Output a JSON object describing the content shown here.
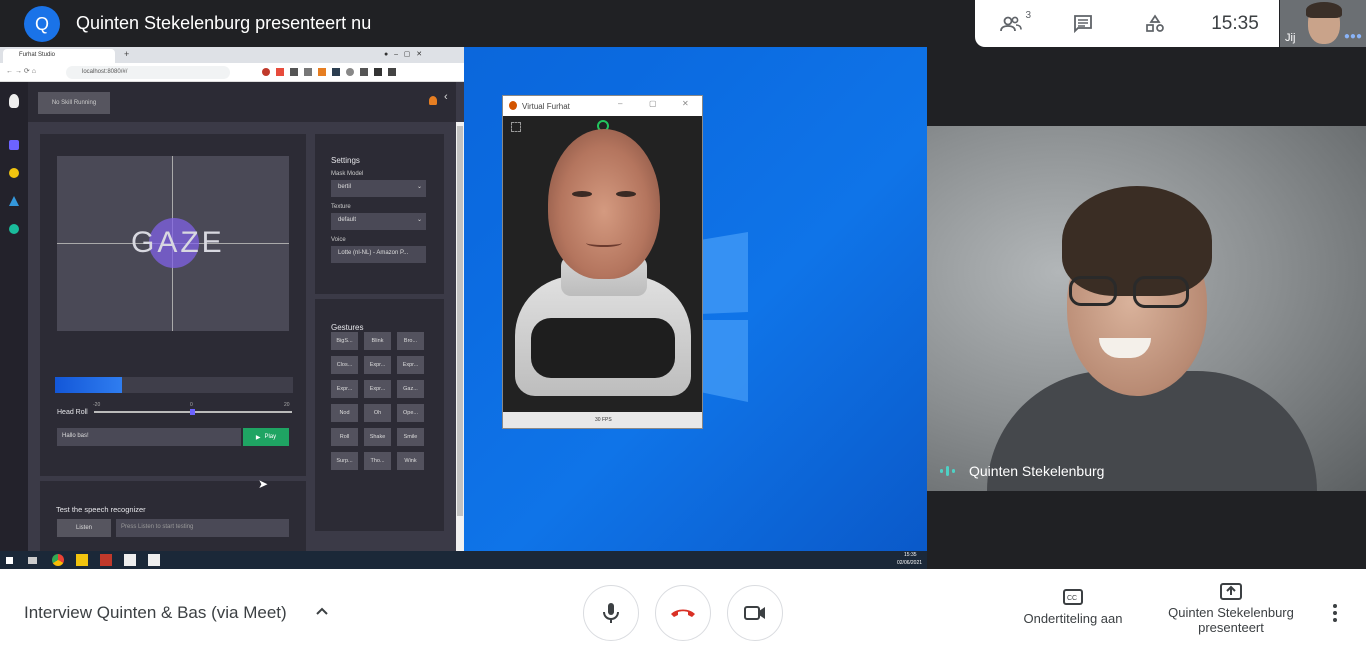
{
  "header": {
    "avatar_letter": "Q",
    "presenting_title": "Quinten Stekelenburg presenteert nu",
    "participant_count": "3",
    "clock": "15:35",
    "self_label": "Jij"
  },
  "shared_screen": {
    "browser": {
      "tab_title": "Furhat Studio",
      "new_tab": "+",
      "url": "localhost:8080/#/",
      "no_skill_button": "No Skill Running",
      "gaze_label": "GAZE",
      "head_roll_label": "Head Roll",
      "head_roll_ticks": [
        "-20",
        "0",
        "20"
      ],
      "head_roll_progress": 0.28,
      "say_input_value": "Hallo bas!",
      "play_button": "Play",
      "settings": {
        "title": "Settings",
        "mask_model_label": "Mask Model",
        "mask_model_value": "bertil",
        "texture_label": "Texture",
        "texture_value": "default",
        "voice_label": "Voice",
        "voice_value": "Lotte (nl-NL) - Amazon P..."
      },
      "gestures": {
        "title": "Gestures",
        "items": [
          "BigS...",
          "Blink",
          "Bro...",
          "Clos...",
          "Expr...",
          "Expr...",
          "Expr...",
          "Expr...",
          "Gaz...",
          "Nod",
          "Oh",
          "Ope...",
          "Roll",
          "Shake",
          "Smile",
          "Surp...",
          "Tho...",
          "Wink"
        ]
      },
      "speech_title": "Test the speech recognizer",
      "listen_button": "Listen",
      "listen_placeholder": "Press Listen to start testing"
    },
    "virtual_furhat": {
      "title": "Virtual Furhat",
      "fps": "30 FPS"
    },
    "taskbar": {
      "time": "15:35",
      "date": "02/06/2021"
    }
  },
  "participant": {
    "name": "Quinten Stekelenburg"
  },
  "bottom_bar": {
    "meeting_title": "Interview Quinten & Bas (via Meet)",
    "captions_label": "Ondertiteling aan",
    "presenting_label_line1": "Quinten Stekelenburg",
    "presenting_label_line2": "presenteert"
  },
  "colors": {
    "meet_blue": "#1a73e8",
    "end_call_red": "#d93025",
    "play_green": "#1fa463",
    "gaze_purple": "#8062e6",
    "desktop_blue": "#0b6ae0"
  }
}
